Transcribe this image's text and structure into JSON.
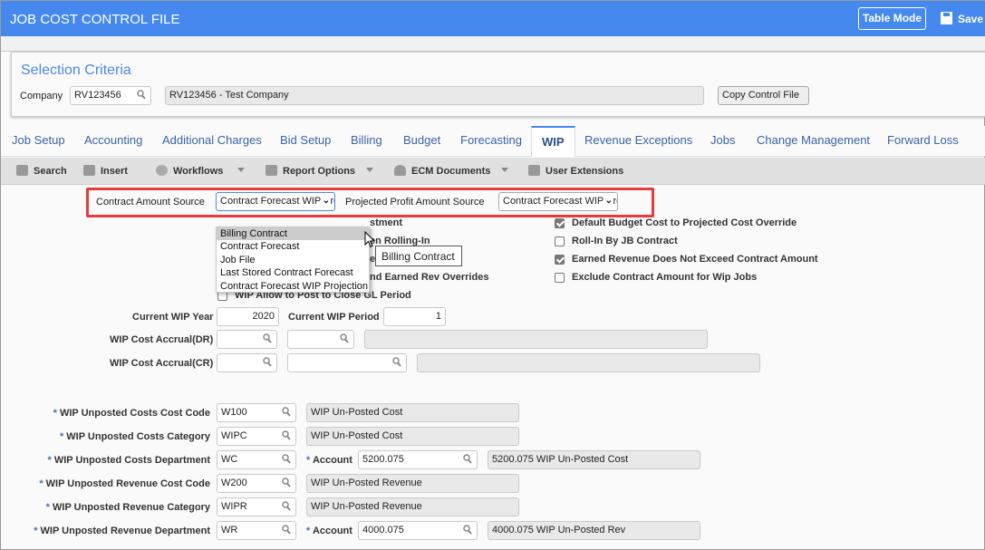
{
  "header": {
    "title": "JOB COST CONTROL FILE",
    "table_mode_label": "Table Mode",
    "save_label": "Save"
  },
  "selection_criteria": {
    "heading": "Selection Criteria",
    "company_label": "Company",
    "company_value": "RV123456",
    "company_description": "RV123456 - Test Company",
    "copy_button_label": "Copy Control File"
  },
  "tabs": [
    {
      "label": "Job Setup"
    },
    {
      "label": "Accounting"
    },
    {
      "label": "Additional Charges"
    },
    {
      "label": "Bid Setup"
    },
    {
      "label": "Billing"
    },
    {
      "label": "Budget"
    },
    {
      "label": "Forecasting"
    },
    {
      "label": "WIP",
      "active": true
    },
    {
      "label": "Revenue Exceptions"
    },
    {
      "label": "Jobs"
    },
    {
      "label": "Change Management"
    },
    {
      "label": "Forward Loss"
    }
  ],
  "toolbar": {
    "search": "Search",
    "insert": "Insert",
    "workflows": "Workflows",
    "report_options": "Report Options",
    "ecm_documents": "ECM Documents",
    "user_extensions": "User Extensions"
  },
  "wip": {
    "contract_amount_source_label": "Contract Amount Source",
    "contract_amount_source_value": "Contract Forecast WIP Projection",
    "projected_profit_source_label": "Projected Profit Amount Source",
    "projected_profit_source_value": "Contract Forecast WIP Projection",
    "dropdown_options": [
      "Billing Contract",
      "Contract Forecast",
      "Job File",
      "Last Stored Contract Forecast",
      "Contract Forecast WIP Projection"
    ],
    "dropdown_highlighted": "Billing Contract",
    "tooltip": "Billing Contract",
    "left_checkboxes_visible_text": [
      "stment",
      "en Rolling-In",
      "e",
      "nd Earned Rev Overrides"
    ],
    "wip_allow_post_label": "WIP Allow to Post to Close GL Period",
    "wip_allow_post_checked": false,
    "right_checkboxes": [
      {
        "label": "Default Budget Cost to Projected Cost Override",
        "checked": true
      },
      {
        "label": "Roll-In By JB Contract",
        "checked": false
      },
      {
        "label": "Earned Revenue Does Not Exceed Contract Amount",
        "checked": true
      },
      {
        "label": "Exclude Contract Amount for Wip Jobs",
        "checked": false
      }
    ],
    "current_wip_year_label": "Current WIP Year",
    "current_wip_year": "2020",
    "current_wip_period_label": "Current WIP Period",
    "current_wip_period": "1",
    "cost_accrual_dr_label": "WIP Cost Accrual(DR)",
    "cost_accrual_cr_label": "WIP Cost Accrual(CR)",
    "account_label": "Account",
    "required_mark": "*",
    "unposted": [
      {
        "label": "WIP Unposted Costs Cost Code",
        "value": "W100",
        "description": "WIP Un-Posted Cost"
      },
      {
        "label": "WIP Unposted Costs Category",
        "value": "WIPC",
        "description": "WIP Un-Posted Cost"
      },
      {
        "label": "WIP Unposted Costs Department",
        "value": "WC",
        "account": "5200.075",
        "account_description": "5200.075 WIP Un-Posted Cost"
      },
      {
        "label": "WIP Unposted Revenue Cost Code",
        "value": "W200",
        "description": "WIP Un-Posted Revenue"
      },
      {
        "label": "WIP Unposted Revenue Category",
        "value": "WIPR",
        "description": "WIP Un-Posted Revenue"
      },
      {
        "label": "WIP Unposted Revenue Department",
        "value": "WR",
        "account": "4000.075",
        "account_description": "4000.075 WIP Un-Posted Rev"
      }
    ]
  }
}
